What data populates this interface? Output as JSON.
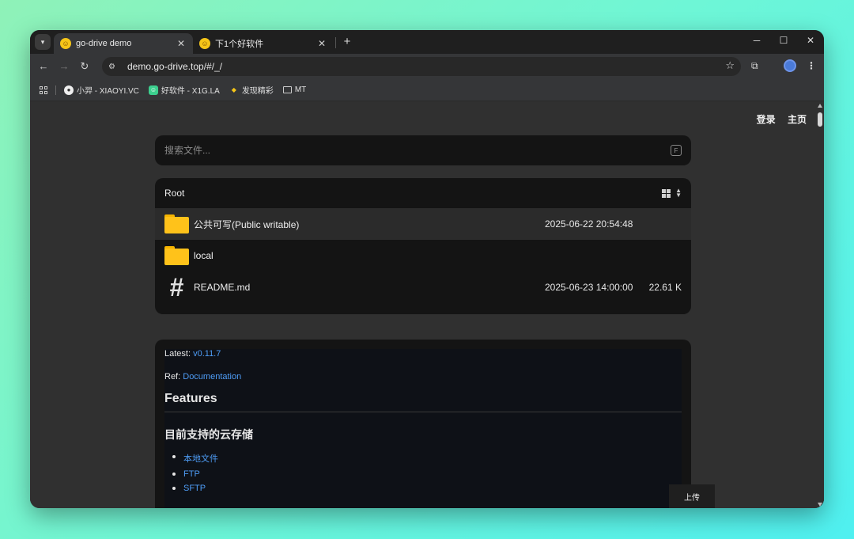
{
  "browser": {
    "tabs": [
      {
        "title": "go-drive demo",
        "active": true
      },
      {
        "title": "下1个好软件",
        "active": false
      }
    ],
    "url": "demo.go-drive.top/#/_/",
    "bookmarks": [
      {
        "label": "小羿 - XIAOYI.VC"
      },
      {
        "label": "好软件 - X1G.LA"
      },
      {
        "label": "发现精彩"
      },
      {
        "label": "MT"
      }
    ]
  },
  "page": {
    "nav": {
      "login": "登录",
      "home": "主页"
    },
    "search": {
      "placeholder": "搜索文件...",
      "shortcut": "F"
    },
    "breadcrumb": "Root",
    "files": [
      {
        "name": "公共可写(Public writable)",
        "type": "folder",
        "modified": "2025-06-22 20:54:48",
        "size": ""
      },
      {
        "name": "local",
        "type": "folder",
        "modified": "",
        "size": ""
      },
      {
        "name": "README.md",
        "type": "markdown",
        "modified": "2025-06-23 14:00:00",
        "size": "22.61 K"
      }
    ],
    "readme": {
      "latest_label": "Latest:",
      "latest_link": "v0.11.7",
      "ref_label": "Ref:",
      "ref_link": "Documentation",
      "features_heading": "Features",
      "storage_heading": "目前支持的云存储",
      "storage_items": [
        "本地文件",
        "FTP",
        "SFTP"
      ]
    },
    "upload_label": "上传"
  },
  "colors": {
    "accent": "#4e9cf5",
    "folder": "#ffc21a",
    "page_bg": "#303030",
    "panel_bg": "#141414"
  }
}
